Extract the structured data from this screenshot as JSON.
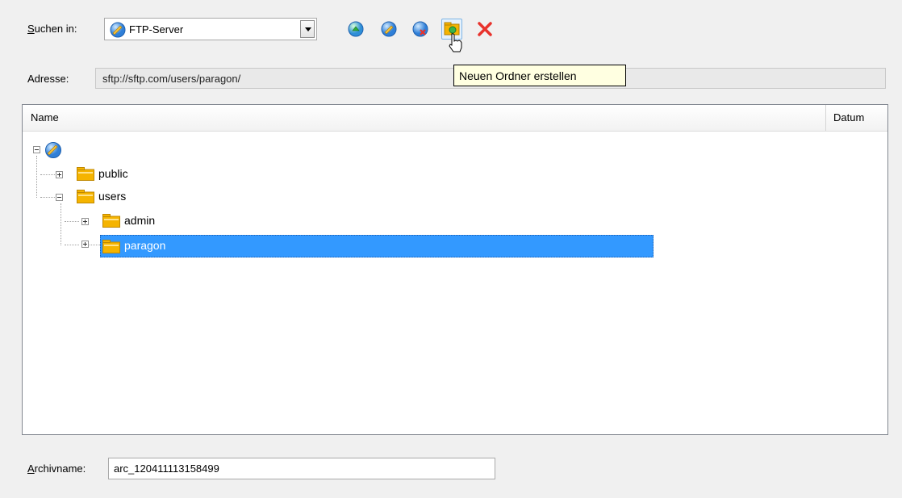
{
  "search": {
    "label_prefix": "S",
    "label_rest": "uchen in:",
    "value": "FTP-Server"
  },
  "toolbar": {
    "buttons": [
      {
        "icon": "globe-up-icon"
      },
      {
        "icon": "globe-edit-icon"
      },
      {
        "icon": "globe-delete-icon"
      },
      {
        "icon": "new-folder-icon"
      },
      {
        "icon": "delete-x-icon"
      }
    ],
    "tooltip": "Neuen Ordner erstellen"
  },
  "address": {
    "label": "Adresse:",
    "value": "sftp://sftp.com/users/paragon/"
  },
  "tree": {
    "columns": [
      "Name",
      "Datum"
    ],
    "nodes": [
      {
        "label": "public"
      },
      {
        "label": "users"
      },
      {
        "label": "admin"
      },
      {
        "label": "paragon",
        "selected": true
      }
    ]
  },
  "archive": {
    "label_prefix": "A",
    "label_rest": "rchivname:",
    "value": "arc_120411113158499"
  },
  "colors": {
    "selection": "#3399ff",
    "folder": "#f5b400",
    "tooltip_bg": "#ffffe1",
    "delete": "#e8322c"
  }
}
